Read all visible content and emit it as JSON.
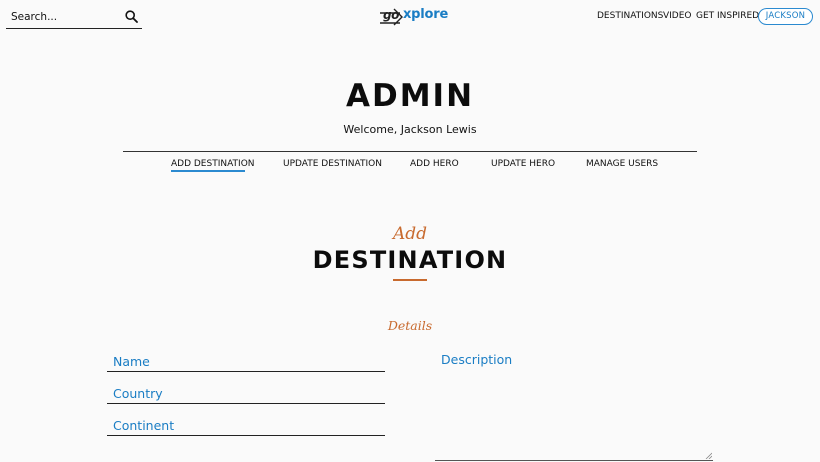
{
  "header": {
    "search_placeholder": "Search...",
    "logo_prefix": "go",
    "logo_suffix": "xplore",
    "nav": [
      "DESTINATIONS",
      "VIDEO",
      "GET INSPIRED"
    ],
    "user": "JACKSON"
  },
  "admin": {
    "title": "ADMIN",
    "welcome": "Welcome, Jackson Lewis",
    "tabs": [
      "ADD DESTINATION",
      "UPDATE DESTINATION",
      "ADD HERO",
      "UPDATE HERO",
      "MANAGE USERS"
    ],
    "active_tab": "ADD DESTINATION"
  },
  "section": {
    "add": "Add",
    "destination": "DESTINATION",
    "details": "Details"
  },
  "form": {
    "name_placeholder": "Name",
    "country_placeholder": "Country",
    "continent_placeholder": "Continent",
    "description_placeholder": "Description"
  },
  "colors": {
    "accent_blue": "#1a7dc4",
    "accent_orange": "#c86a2e",
    "background": "#fafafa"
  },
  "icons": [
    "search-icon",
    "logo-arrow-icon",
    "resize-grip-icon"
  ]
}
